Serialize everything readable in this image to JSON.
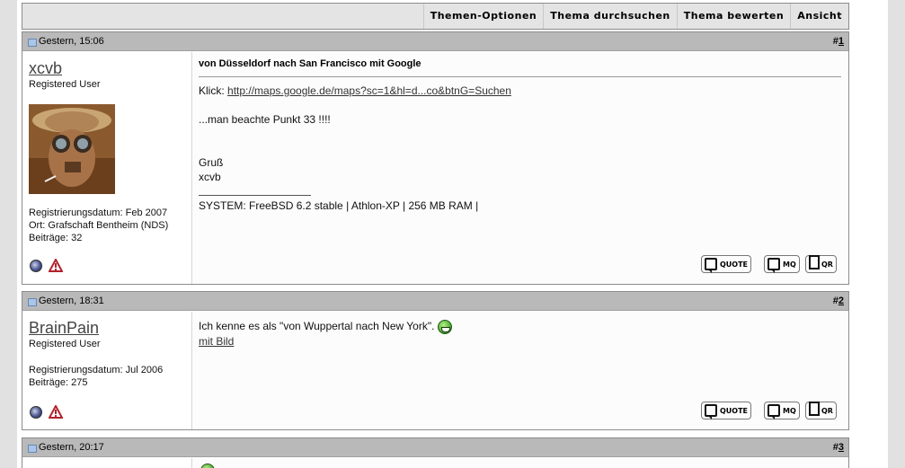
{
  "toolbar": {
    "thread_options": "Themen-Optionen",
    "search_thread": "Thema durchsuchen",
    "rate_thread": "Thema bewerten",
    "view": "Ansicht"
  },
  "posts": [
    {
      "date": "Gestern, 15:06",
      "number_hash": "#",
      "number": "1",
      "username": "xcvb",
      "user_title": "Registered User",
      "reg_date": "Registrierungsdatum: Feb 2007",
      "location": "Ort: Grafschaft Bentheim (NDS)",
      "post_count": "Beiträge: 32",
      "title": "von Düsseldorf nach San Francisco mit Google",
      "click_label": "Klick: ",
      "link": "http://maps.google.de/maps?sc=1&hl=d...co&btnG=Suchen",
      "line2": "...man beachte Punkt 33 !!!!",
      "greeting": "Gruß",
      "signoff": "xcvb",
      "signature": "SYSTEM: FreeBSD 6.2 stable | Athlon-XP | 256 MB RAM |"
    },
    {
      "date": "Gestern, 18:31",
      "number_hash": "#",
      "number": "2",
      "username": "BrainPain",
      "user_title": "Registered User",
      "reg_date": "Registrierungsdatum: Jul 2006",
      "post_count": "Beiträge: 275",
      "text": "Ich kenne es als \"von Wuppertal nach New York\".",
      "link": "mit Bild"
    },
    {
      "date": "Gestern, 20:17",
      "number_hash": "#",
      "number": "3"
    }
  ],
  "buttons": {
    "quote": "QUOTE",
    "multiquote": "MQ",
    "quickreply": "QR"
  },
  "icons": {
    "post_icon": "post-icon",
    "status": "offline-status-icon",
    "report": "report-post-icon",
    "smiley": "grin-smiley-icon"
  },
  "colors": {
    "background": "#e1e1e1",
    "post_header": "#b9b9b9",
    "border": "#8c8c8c"
  }
}
